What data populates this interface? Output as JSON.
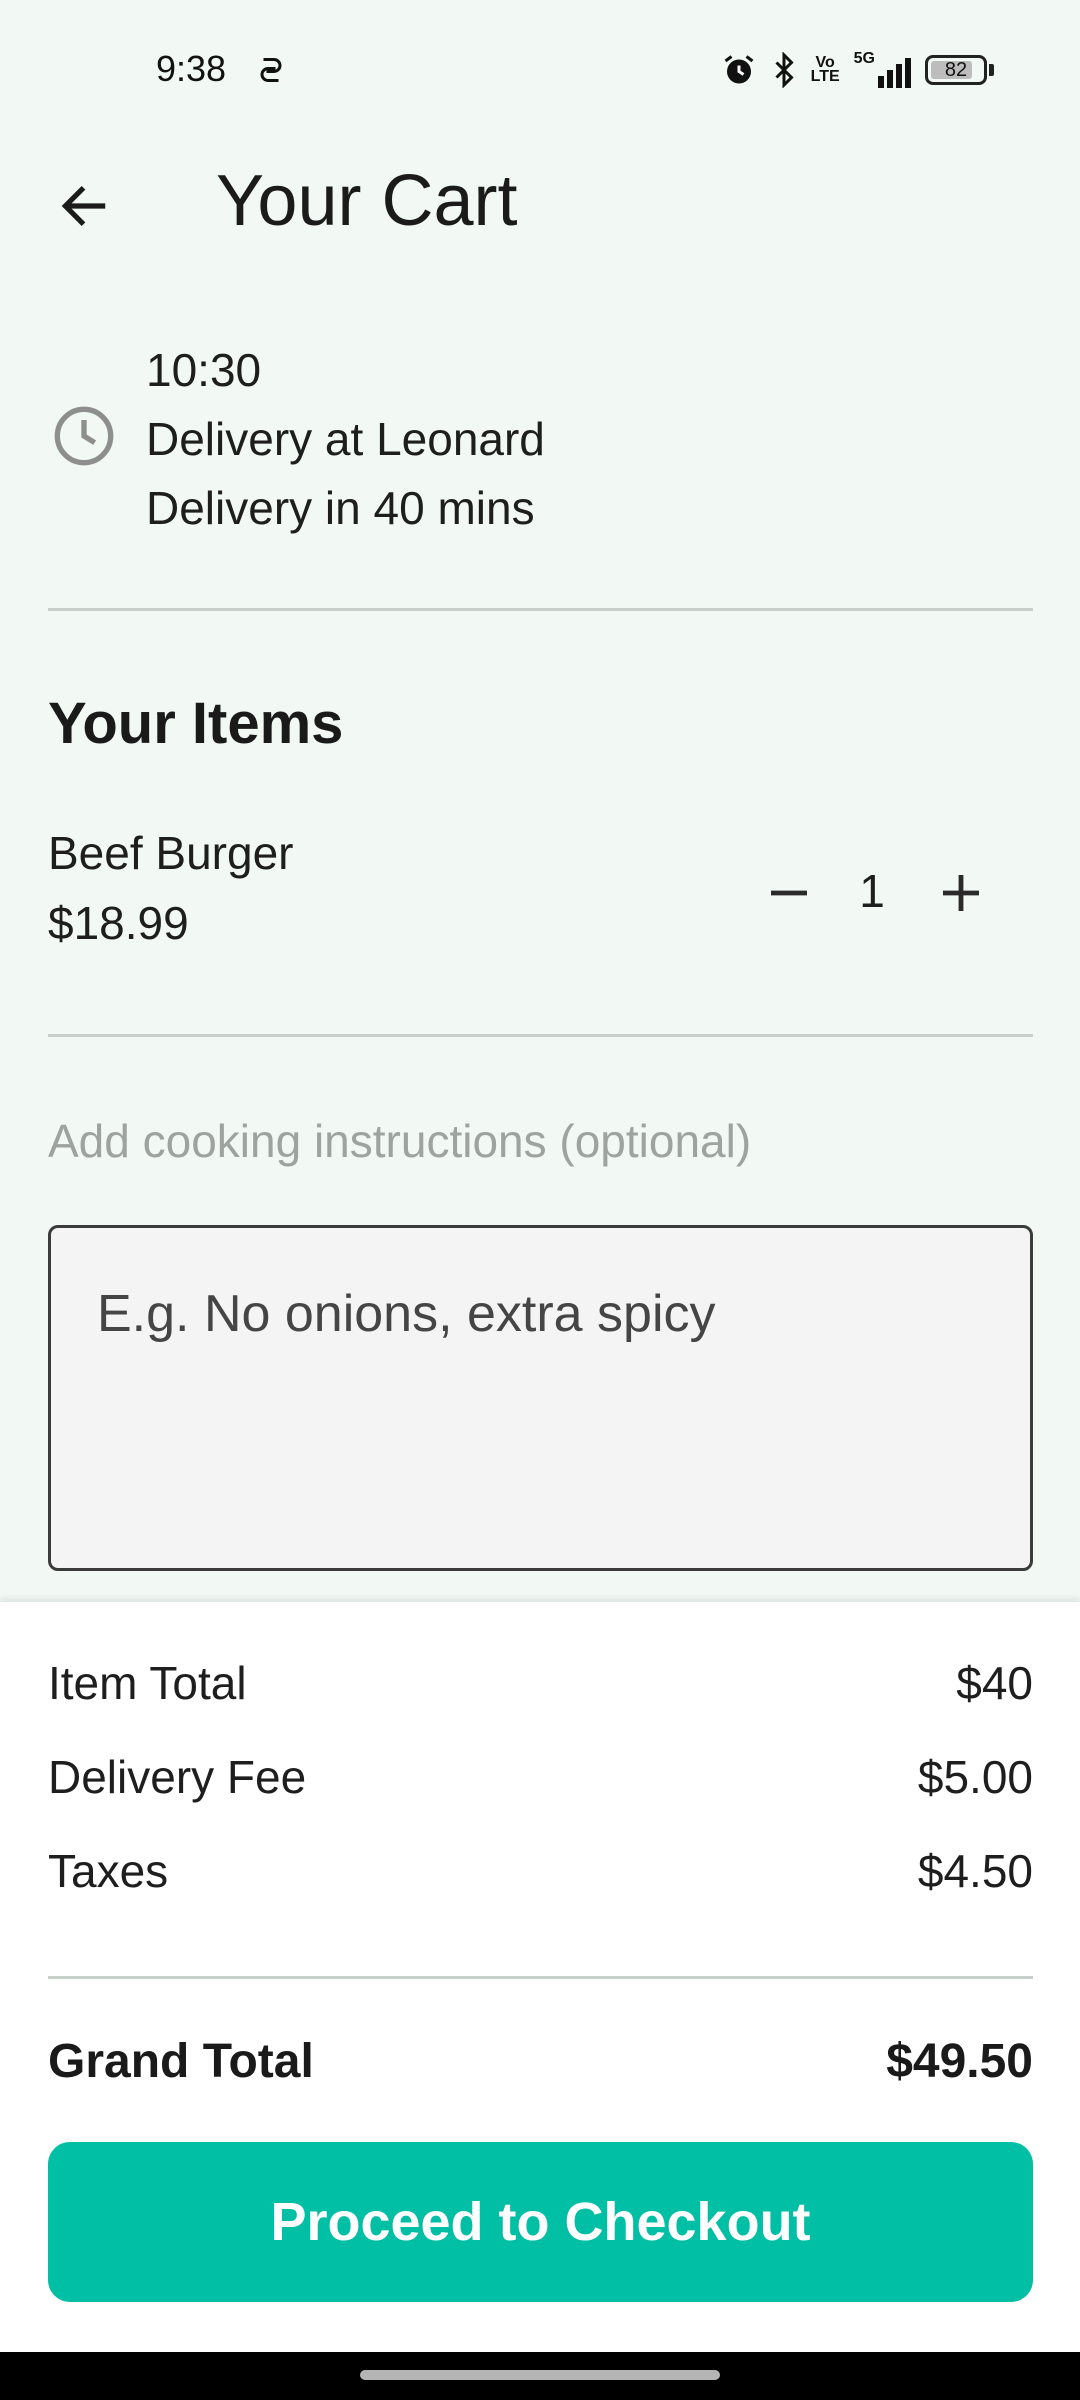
{
  "status_bar": {
    "time": "9:38",
    "net_top": "Vo",
    "net_bottom": "LTE",
    "network": "5G",
    "battery": "82",
    "battery_level": 0.82,
    "icons": [
      "sync-icon",
      "alarm-icon",
      "bluetooth-icon",
      "volte-icon",
      "signal-5g-icon",
      "battery-icon"
    ]
  },
  "app_bar": {
    "title": "Your Cart",
    "back_icon": "arrow-back-icon"
  },
  "delivery": {
    "icon": "clock-icon",
    "time": "10:30",
    "location": "Delivery at Leonard",
    "eta": "Delivery in 40 mins"
  },
  "items_section": {
    "heading": "Your Items",
    "items": [
      {
        "name": "Beef Burger",
        "price": "$18.99",
        "quantity": "1"
      }
    ]
  },
  "instructions": {
    "label": "Add cooking instructions (optional)",
    "placeholder": "E.g. No onions, extra spicy",
    "value": ""
  },
  "summary": {
    "rows": [
      {
        "label": "Item Total",
        "value": "$40"
      },
      {
        "label": "Delivery Fee",
        "value": "$5.00"
      },
      {
        "label": "Taxes",
        "value": "$4.50"
      }
    ],
    "grand_total_label": "Grand Total",
    "grand_total_value": "$49.50",
    "checkout_label": "Proceed to Checkout"
  },
  "colors": {
    "background": "#f2f8f4",
    "accent": "#00bfa5",
    "divider": "#c8cfcb",
    "muted_text": "#9ea3a0"
  }
}
